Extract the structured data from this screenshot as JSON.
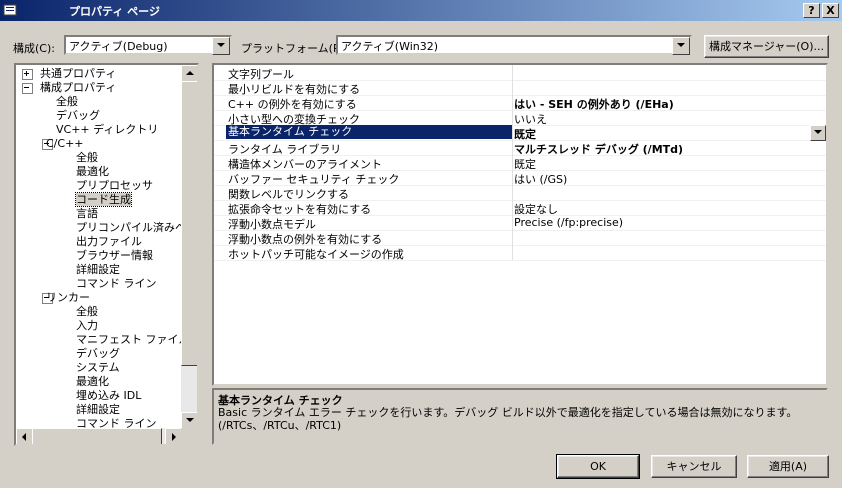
{
  "window": {
    "title": "プロパティ ページ",
    "help_btn": "?",
    "close_btn": "X"
  },
  "toolbar": {
    "config_label": "構成(C):",
    "config_value": "アクティブ(Debug)",
    "platform_label": "プラットフォーム(P):",
    "platform_value": "アクティブ(Win32)",
    "config_manager_btn": "構成マネージャー(O)..."
  },
  "tree": {
    "items": [
      {
        "label": "共通プロパティ",
        "expander": "+"
      },
      {
        "label": "構成プロパティ",
        "expander": "-"
      },
      {
        "label": "全般"
      },
      {
        "label": "デバッグ"
      },
      {
        "label": "VC++ ディレクトリ"
      },
      {
        "label": "C/C++",
        "expander": "-"
      },
      {
        "label": "全般"
      },
      {
        "label": "最適化"
      },
      {
        "label": "プリプロセッサ"
      },
      {
        "label": "コード生成",
        "selected": true
      },
      {
        "label": "言語"
      },
      {
        "label": "プリコンパイル済みヘッダ"
      },
      {
        "label": "出力ファイル"
      },
      {
        "label": "ブラウザー情報"
      },
      {
        "label": "詳細設定"
      },
      {
        "label": "コマンド ライン"
      },
      {
        "label": "リンカー",
        "expander": "-"
      },
      {
        "label": "全般"
      },
      {
        "label": "入力"
      },
      {
        "label": "マニフェスト ファイル"
      },
      {
        "label": "デバッグ"
      },
      {
        "label": "システム"
      },
      {
        "label": "最適化"
      },
      {
        "label": "埋め込み IDL"
      },
      {
        "label": "詳細設定"
      },
      {
        "label": "コマンド ライン"
      }
    ]
  },
  "grid": {
    "rows": [
      {
        "name": "文字列プール",
        "value": ""
      },
      {
        "name": "最小リビルドを有効にする",
        "value": ""
      },
      {
        "name": "C++ の例外を有効にする",
        "value": "はい - SEH の例外あり (/EHa)",
        "bold": true
      },
      {
        "name": "小さい型への変換チェック",
        "value": "いいえ"
      },
      {
        "name": "基本ランタイム チェック",
        "value": "既定",
        "bold": true,
        "selected": true
      },
      {
        "name": "ランタイム ライブラリ",
        "value": "マルチスレッド デバッグ (/MTd)",
        "bold": true
      },
      {
        "name": "構造体メンバーのアライメント",
        "value": "既定"
      },
      {
        "name": "バッファー セキュリティ チェック",
        "value": "はい (/GS)"
      },
      {
        "name": "関数レベルでリンクする",
        "value": ""
      },
      {
        "name": "拡張命令セットを有効にする",
        "value": "設定なし"
      },
      {
        "name": "浮動小数点モデル",
        "value": "Precise (/fp:precise)"
      },
      {
        "name": "浮動小数点の例外を有効にする",
        "value": ""
      },
      {
        "name": "ホットパッチ可能なイメージの作成",
        "value": ""
      }
    ]
  },
  "description": {
    "title": "基本ランタイム チェック",
    "text": "Basic ランタイム エラー チェックを行います。デバッグ ビルド以外で最適化を指定している場合は無効になります。　(/RTCs、/RTCu、/RTC1)"
  },
  "buttons": {
    "ok": "OK",
    "cancel": "キャンセル",
    "apply": "適用(A)"
  }
}
